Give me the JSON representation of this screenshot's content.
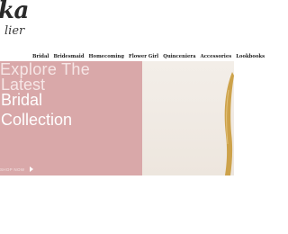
{
  "brand": {
    "logo_main": "ka",
    "logo_sub": "lier"
  },
  "nav": {
    "items": [
      {
        "label": "Bridal"
      },
      {
        "label": "Bridesmaid"
      },
      {
        "label": "Homecoming"
      },
      {
        "label": "Flower Girl"
      },
      {
        "label": "Quinceniera"
      },
      {
        "label": "Accessories"
      },
      {
        "label": "Lookbooks"
      }
    ]
  },
  "hero": {
    "line1": "Explore The",
    "line2": "Latest",
    "line3": "Bridal",
    "line4": "Collection",
    "cta_label": "SHOP NOW",
    "colors": {
      "pink_panel": "#d9a8a9",
      "photo_bg": "#f1ebe5",
      "gold": "#c99a3a"
    }
  }
}
